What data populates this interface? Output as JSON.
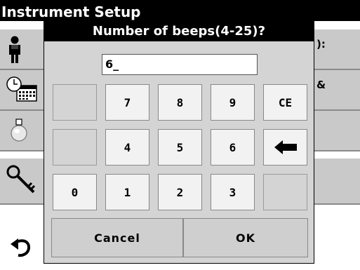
{
  "screen": {
    "title": "Instrument Setup"
  },
  "right_panel": {
    "items": [
      "):",
      "&",
      "",
      ""
    ]
  },
  "dialog": {
    "title": "Number of beeps(4-25)?",
    "input_value": "6_"
  },
  "keypad": {
    "row1": [
      "7",
      "8",
      "9",
      "CE"
    ],
    "row2": [
      "4",
      "5",
      "6"
    ],
    "row3": [
      "0",
      "1",
      "2",
      "3"
    ],
    "backspace_icon": "left-arrow-icon",
    "cancel_label": "Cancel",
    "ok_label": "OK"
  },
  "sidebar": {
    "icons": [
      "person-icon",
      "clock-calendar-icon",
      "lamp-icon",
      "key-icon",
      "back-arrow-icon"
    ]
  }
}
